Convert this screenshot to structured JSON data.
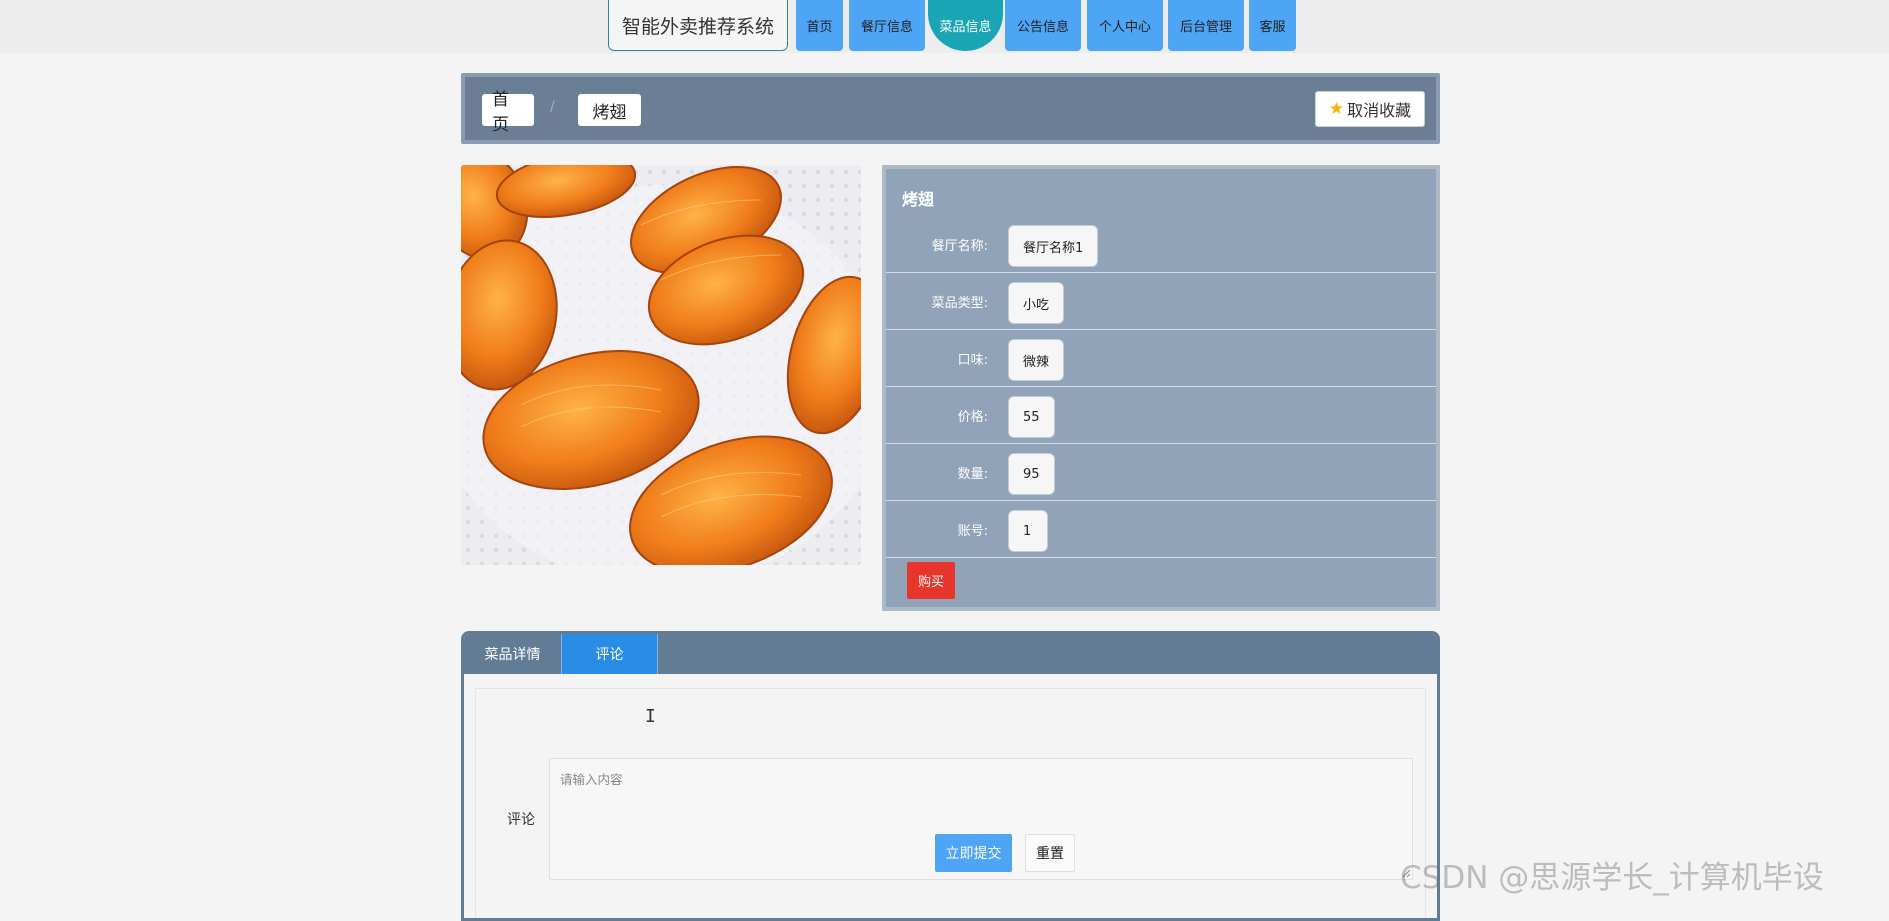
{
  "header": {
    "brand": "智能外卖推荐系统",
    "nav": [
      {
        "label": "首页",
        "active": false
      },
      {
        "label": "餐厅信息",
        "active": false
      },
      {
        "label": "菜品信息",
        "active": true
      },
      {
        "label": "公告信息",
        "active": false
      },
      {
        "label": "个人中心",
        "active": false
      },
      {
        "label": "后台管理",
        "active": false
      },
      {
        "label": "客服",
        "active": false
      }
    ]
  },
  "breadcrumb": {
    "home": "首页",
    "separator": "/",
    "current": "烤翅",
    "favorite_label": "取消收藏",
    "favorite_icon": "star-icon"
  },
  "dish": {
    "image_alt": "烤翅",
    "title": "烤翅",
    "fields": [
      {
        "label": "餐厅名称:",
        "value": "餐厅名称1"
      },
      {
        "label": "菜品类型:",
        "value": "小吃"
      },
      {
        "label": "口味:",
        "value": "微辣"
      },
      {
        "label": "价格:",
        "value": "55"
      },
      {
        "label": "数量:",
        "value": "95"
      },
      {
        "label": "账号:",
        "value": "1"
      }
    ],
    "buy_label": "购买"
  },
  "tabs": {
    "items": [
      {
        "label": "菜品详情",
        "active": false
      },
      {
        "label": "评论",
        "active": true
      }
    ]
  },
  "comment": {
    "label": "评论",
    "placeholder": "请输入内容",
    "value": "",
    "submit_label": "立即提交",
    "reset_label": "重置"
  },
  "watermark": "CSDN @思源学长_计算机毕设",
  "colors": {
    "nav_blue": "#4ea4f5",
    "nav_active": "#1aa5b5",
    "panel": "#91a3b8",
    "header_bar": "#6a7f96",
    "buy_red": "#e8352b",
    "tab_active": "#2a8ce5"
  }
}
